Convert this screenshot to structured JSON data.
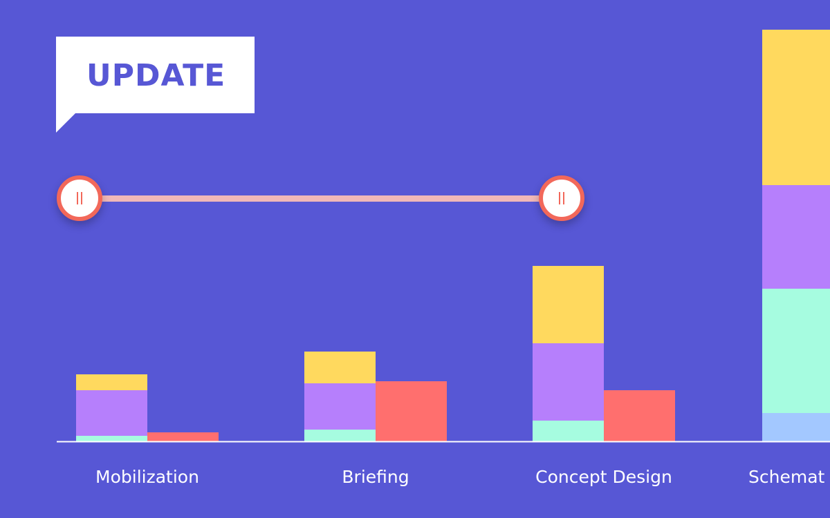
{
  "badge": {
    "text": "UPDATE"
  },
  "slider": {
    "range_start_category": "Mobilization",
    "range_end_category": "Concept Design"
  },
  "chart_data": {
    "type": "bar",
    "stacked": true,
    "grid": false,
    "legend": "none",
    "categories": [
      "Mobilization",
      "Briefing",
      "Concept Design",
      "Schemat"
    ],
    "stack_series": [
      {
        "color": "#A3C8FF",
        "values": [
          0,
          0,
          0,
          41
        ]
      },
      {
        "color": "#A6FCE0",
        "values": [
          8,
          17,
          30,
          180
        ]
      },
      {
        "color": "#B67FFC",
        "values": [
          66,
          67,
          112,
          150
        ]
      },
      {
        "color": "#FFD95E",
        "values": [
          23,
          46,
          112,
          225
        ]
      }
    ],
    "side_series": {
      "color": "#FF6F6E",
      "values": [
        13,
        87,
        74,
        null
      ]
    }
  },
  "colors": {
    "background": "#5757D5",
    "slider_track": "#F0B8B8",
    "slider_handle": "#F2685A"
  }
}
